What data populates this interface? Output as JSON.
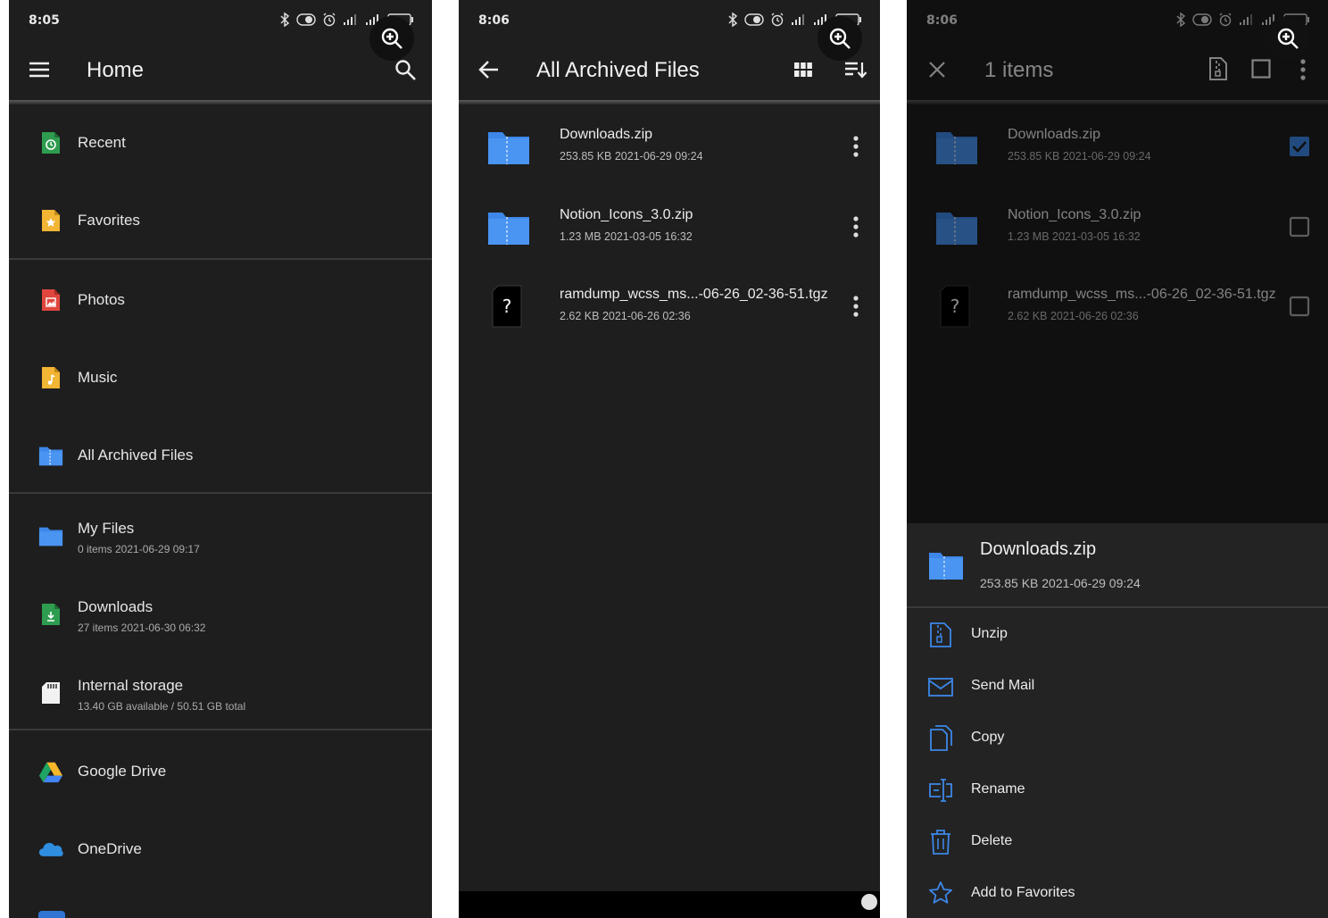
{
  "screens": [
    {
      "status_time": "8:05",
      "title": "Home",
      "nav_items": [
        {
          "label": "Recent"
        },
        {
          "label": "Favorites"
        },
        {
          "label": "Photos"
        },
        {
          "label": "Music"
        },
        {
          "label": "All Archived Files"
        },
        {
          "label": "My Files",
          "sub": "0 items  2021-06-29 09:17"
        },
        {
          "label": "Downloads",
          "sub": "27 items  2021-06-30 06:32"
        },
        {
          "label": "Internal storage",
          "sub": "13.40 GB available / 50.51 GB total"
        },
        {
          "label": "Google Drive"
        },
        {
          "label": "OneDrive"
        }
      ]
    },
    {
      "status_time": "8:06",
      "title": "All Archived Files",
      "files": [
        {
          "name": "Downloads.zip",
          "meta": "253.85 KB  2021-06-29 09:24"
        },
        {
          "name": "Notion_Icons_3.0.zip",
          "meta": "1.23 MB  2021-03-05 16:32"
        },
        {
          "name": "ramdump_wcss_ms...-06-26_02-36-51.tgz",
          "meta": "2.62 KB  2021-06-26 02:36"
        }
      ]
    },
    {
      "status_time": "8:06",
      "title": "1 items",
      "files": [
        {
          "name": "Downloads.zip",
          "meta": "253.85 KB  2021-06-29 09:24",
          "checked": true
        },
        {
          "name": "Notion_Icons_3.0.zip",
          "meta": "1.23 MB  2021-03-05 16:32",
          "checked": false
        },
        {
          "name": "ramdump_wcss_ms...-06-26_02-36-51.tgz",
          "meta": "2.62 KB  2021-06-26 02:36",
          "checked": false
        }
      ],
      "sheet": {
        "name": "Downloads.zip",
        "meta": "253.85 KB  2021-06-29 09:24",
        "actions": [
          {
            "label": "Unzip"
          },
          {
            "label": "Send Mail"
          },
          {
            "label": "Copy"
          },
          {
            "label": "Rename"
          },
          {
            "label": "Delete"
          },
          {
            "label": "Add to Favorites"
          }
        ]
      }
    }
  ],
  "colors": {
    "background": "#1e1e1e",
    "accent_blue": "#3d87e8",
    "text": "#e6e6e6",
    "subtext": "#aaaaaa"
  }
}
